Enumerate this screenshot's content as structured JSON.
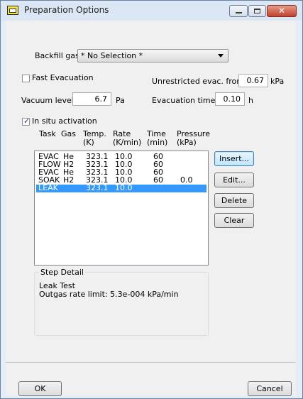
{
  "window": {
    "title": "Preparation Options",
    "minimize_icon": "minimize-icon",
    "maximize_icon": "maximize-icon",
    "close_glyph": "✕"
  },
  "backfill": {
    "label": "Backfill gas:",
    "value": "* No Selection *"
  },
  "fast_evacuation": {
    "label": "Fast Evacuation",
    "checked": false
  },
  "unrestricted": {
    "label": "Unrestricted evac. from:",
    "value": "0.67",
    "unit": "kPa"
  },
  "vacuum": {
    "label": "Vacuum level:",
    "value": "6.7",
    "unit": "Pa"
  },
  "evac_time": {
    "label": "Evacuation time:",
    "value": "0.10",
    "unit": "h"
  },
  "insitu": {
    "label": "In situ activation",
    "checked": true
  },
  "headers": {
    "task": "Task",
    "gas": "Gas",
    "temp": "Temp.",
    "temp_unit": "(K)",
    "rate": "Rate",
    "rate_unit": "(K/min)",
    "time": "Time",
    "time_unit": "(min)",
    "pressure": "Pressure",
    "pressure_unit": "(kPa)"
  },
  "rows": [
    {
      "task": "EVAC",
      "gas": "He",
      "temp": "323.1",
      "rate": "10.0",
      "time": "60",
      "pressure": ""
    },
    {
      "task": "FLOW",
      "gas": "H2",
      "temp": "323.1",
      "rate": "10.0",
      "time": "60",
      "pressure": ""
    },
    {
      "task": "EVAC",
      "gas": "He",
      "temp": "323.1",
      "rate": "10.0",
      "time": "60",
      "pressure": ""
    },
    {
      "task": "SOAK",
      "gas": "H2",
      "temp": "323.1",
      "rate": "10.0",
      "time": "60",
      "pressure": "0.0"
    },
    {
      "task": "LEAK",
      "gas": "",
      "temp": "323.1",
      "rate": "10.0",
      "time": "",
      "pressure": ""
    }
  ],
  "selected_row": 4,
  "buttons": {
    "insert": "Insert...",
    "edit": "Edit...",
    "delete": "Delete",
    "clear": "Clear",
    "ok": "OK",
    "cancel": "Cancel"
  },
  "step_detail": {
    "title": "Step Detail",
    "line1": "Leak Test",
    "line2": "Outgas rate limit: 5.3e-004 kPa/min"
  },
  "colors": {
    "selection": "#3399ff",
    "close_button": "#c0422e"
  }
}
